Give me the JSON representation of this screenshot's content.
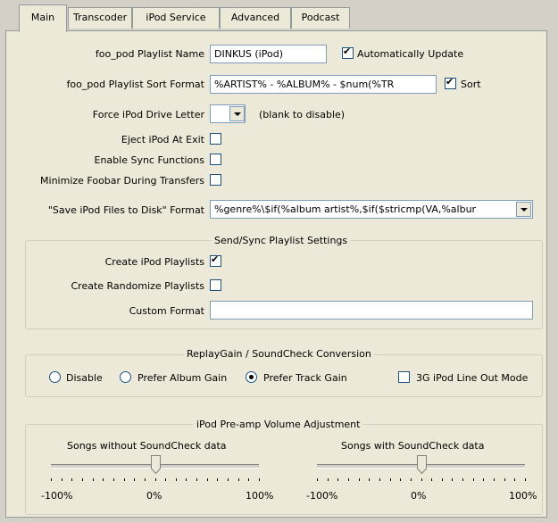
{
  "tabs": [
    "Main",
    "Transcoder",
    "iPod Service",
    "Advanced",
    "Podcast"
  ],
  "main": {
    "playlist_name_label": "foo_pod Playlist Name",
    "playlist_name_value": "DINKUS (iPod)",
    "auto_update_label": "Automatically Update",
    "auto_update_checked": true,
    "sort_format_label": "foo_pod Playlist Sort Format",
    "sort_format_value": "%ARTIST% - %ALBUM% - $num(%TR",
    "sort_label": "Sort",
    "sort_checked": true,
    "drive_letter_label": "Force iPod Drive Letter",
    "drive_letter_value": "",
    "drive_letter_hint": "(blank to disable)",
    "eject_label": "Eject iPod At Exit",
    "eject_checked": false,
    "sync_label": "Enable Sync Functions",
    "sync_checked": false,
    "minimize_label": "Minimize Foobar During Transfers",
    "minimize_checked": false,
    "save_format_label": "\"Save iPod Files to Disk\" Format",
    "save_format_value": "%genre%\\$if(%album artist%,$if($stricmp(VA,%albur"
  },
  "sync_group": {
    "title": "Send/Sync Playlist Settings",
    "create_playlists_label": "Create iPod Playlists",
    "create_playlists_checked": true,
    "randomize_label": "Create Randomize Playlists",
    "randomize_checked": false,
    "custom_format_label": "Custom Format",
    "custom_format_value": ""
  },
  "replaygain_group": {
    "title": "ReplayGain / SoundCheck Conversion",
    "options": [
      "Disable",
      "Prefer Album Gain",
      "Prefer Track Gain"
    ],
    "selected": "Prefer Track Gain",
    "lineout_label": "3G iPod Line Out Mode",
    "lineout_checked": false
  },
  "preamp_group": {
    "title": "iPod Pre-amp Volume Adjustment",
    "without_label": "Songs without SoundCheck data",
    "with_label": "Songs with SoundCheck data",
    "scale_min": "-100%",
    "scale_mid": "0%",
    "scale_max": "100%",
    "without_value_percent": 0,
    "with_value_percent": 0
  }
}
